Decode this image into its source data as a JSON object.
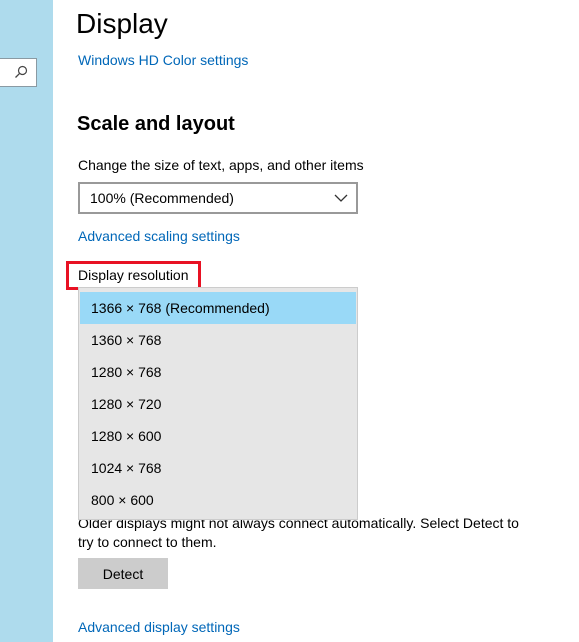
{
  "sidebar": {
    "search": {
      "icon": "search-icon"
    }
  },
  "main": {
    "title": "Display",
    "hd_color_link": "Windows HD Color settings",
    "scale_section": {
      "title": "Scale and layout",
      "scale_label": "Change the size of text, apps, and other items",
      "scale_selected": "100% (Recommended)",
      "advanced_scaling_link": "Advanced scaling settings",
      "resolution_label": "Display resolution",
      "resolution_options": [
        "1366 × 768 (Recommended)",
        "1360 × 768",
        "1280 × 768",
        "1280 × 720",
        "1280 × 600",
        "1024 × 768",
        "800 × 600"
      ],
      "resolution_selected_index": 0
    },
    "multiple_displays": {
      "description": "Older displays might not always connect automatically. Select Detect to try to connect to them.",
      "detect_button": "Detect"
    },
    "advanced_display_link": "Advanced display settings"
  },
  "colors": {
    "sidebar_bg": "#aedbed",
    "link": "#0067b8",
    "selected_item": "#99d9f7",
    "dropdown_bg": "#e6e6e6",
    "highlight_border": "#e81123",
    "button_bg": "#cccccc"
  }
}
